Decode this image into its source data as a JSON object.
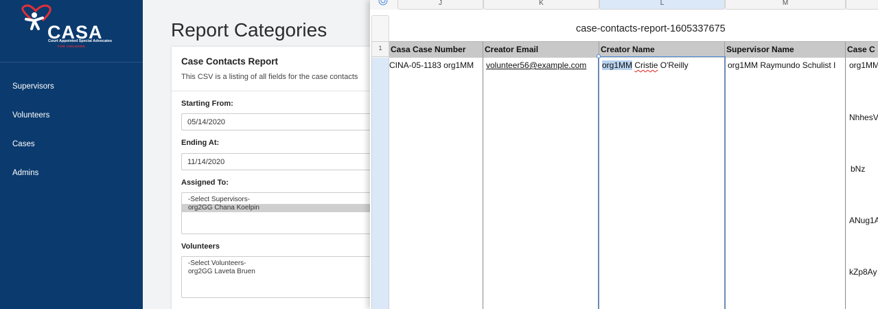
{
  "sidebar": {
    "logo": {
      "text": "CASA",
      "subtitle": "Court Appointed Special Advocates",
      "subtitle2": "FOR CHILDREN"
    },
    "items": [
      {
        "label": "Supervisors"
      },
      {
        "label": "Volunteers"
      },
      {
        "label": "Cases"
      },
      {
        "label": "Admins"
      }
    ]
  },
  "page": {
    "title": "Report Categories",
    "card": {
      "title": "Case Contacts Report",
      "description": "This CSV is a listing of all fields for the case contacts",
      "starting_label": "Starting From:",
      "starting_value": "05/14/2020",
      "ending_label": "Ending At:",
      "ending_value": "11/14/2020",
      "assigned_label": "Assigned To:",
      "assigned_options": [
        "-Select Supervisors-",
        "org2GG Chana Koelpin"
      ],
      "volunteers_label": "Volunteers",
      "volunteer_options": [
        "-Select Volunteers-",
        "org2GG Laveta Bruen"
      ]
    }
  },
  "sheet": {
    "columns": [
      "J",
      "K",
      "L",
      "M"
    ],
    "active_column": "L",
    "title": "case-contacts-report-1605337675",
    "row_number": "1",
    "headers": [
      "Casa Case Number",
      "Creator Email",
      "Creator Name",
      "Supervisor Name",
      "Case C"
    ],
    "row": {
      "case_number": "CINA-05-1183 org1MM",
      "email": "volunteer56@example.com",
      "name_prefix": "org1MM",
      "name_first": "Cristie",
      "name_last": "O'Reilly",
      "supervisor": "org1MM Raymundo Schulist I"
    },
    "next_column_fragments": [
      "org1MM",
      "NhhesV",
      "bNz",
      "ANug1A",
      "kZp8Ay"
    ]
  },
  "colors": {
    "sidebar": "#0b3a6e",
    "accent_red": "#e0303a",
    "selection": "#dbe8f8"
  }
}
